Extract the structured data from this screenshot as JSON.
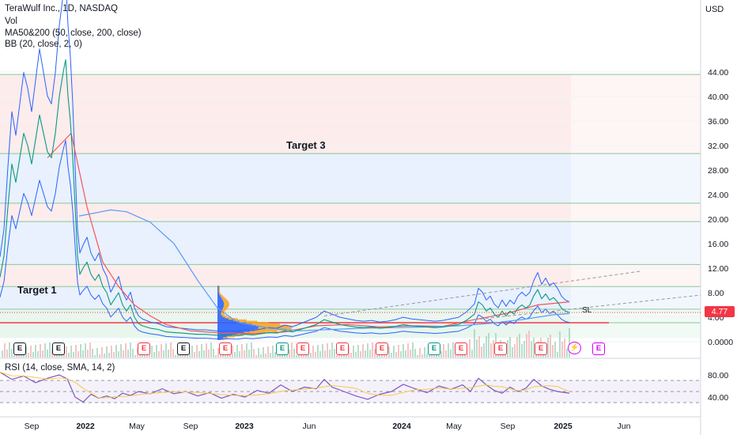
{
  "header": {
    "title": "TeraWulf Inc., 1D, NASDAQ",
    "vol_label": "Vol",
    "ma_label": "MA50&200 (50, close, 200, close)",
    "bb_label": "BB (20, close, 2, 0)",
    "rsi_label": "RSI (14, close, SMA, 14, 2)",
    "currency": "USD"
  },
  "annotations": {
    "target1": "Target 1",
    "target3": "Target 3",
    "sl": "SL",
    "last_price": "4.77"
  },
  "colors": {
    "price_line": "#f23645",
    "bb_band": "#2962ff",
    "ma50": "#f7525f",
    "ma200": "#5b9cf6",
    "rsi": "#7e57c2",
    "volume_profile_up": "#2962ff",
    "volume_profile_down": "#f5a623",
    "earnings_red": "#f23645",
    "earnings_green": "#089981",
    "zone_red": "#fdecec",
    "zone_blue": "#e8f1fd",
    "zone_green": "#e8f6ee"
  },
  "chart_data": [
    {
      "type": "line",
      "ylim": [
        0,
        48
      ],
      "y_ticks": [
        0,
        4,
        8,
        12,
        16,
        20,
        24,
        28,
        32,
        36,
        40,
        44
      ],
      "y_tick_labels": [
        "0.0000",
        "4.00",
        "8.00",
        "12.00",
        "16.00",
        "20.00",
        "24.00",
        "28.00",
        "32.00",
        "36.00",
        "40.00",
        "44.00"
      ],
      "x_tick_labels": [
        "Sep",
        "2022",
        "May",
        "Sep",
        "2023",
        "Jun",
        "2024",
        "May",
        "Sep",
        "2025",
        "Jun"
      ],
      "last_price": 4.77,
      "zones": [
        {
          "from": 30.7,
          "to": 43.6,
          "color": "red"
        },
        {
          "from": 22.6,
          "to": 30.7,
          "color": "blue"
        },
        {
          "from": 19.6,
          "to": 22.6,
          "color": "red"
        },
        {
          "from": 12.6,
          "to": 19.6,
          "color": "blue"
        },
        {
          "from": 9.0,
          "to": 12.6,
          "color": "red"
        },
        {
          "from": 5.3,
          "to": 9.0,
          "color": "blue"
        },
        {
          "from": 3.1,
          "to": 5.3,
          "color": "green"
        },
        {
          "from": 0.6,
          "to": 3.1,
          "color": "green"
        }
      ],
      "series": [
        {
          "values": [
            [
              0,
              10.5
            ],
            [
              5,
              14
            ],
            [
              10,
              22
            ],
            [
              15,
              29
            ],
            [
              20,
              26
            ],
            [
              25,
              30
            ],
            [
              30,
              34
            ],
            [
              35,
              32
            ],
            [
              40,
              29
            ],
            [
              45,
              33
            ],
            [
              50,
              37
            ],
            [
              55,
              34
            ],
            [
              60,
              31
            ],
            [
              65,
              30
            ],
            [
              70,
              34
            ],
            [
              75,
              40
            ],
            [
              80,
              44
            ],
            [
              83,
              46
            ],
            [
              86,
              40
            ],
            [
              89,
              36
            ],
            [
              92,
              30
            ],
            [
              95,
              22
            ],
            [
              98,
              14
            ],
            [
              101,
              11
            ],
            [
              105,
              12
            ],
            [
              110,
              13
            ],
            [
              115,
              11
            ],
            [
              120,
              10
            ],
            [
              125,
              11
            ],
            [
              130,
              9
            ],
            [
              135,
              8
            ],
            [
              140,
              6
            ],
            [
              145,
              7
            ],
            [
              150,
              8
            ],
            [
              155,
              6
            ],
            [
              160,
              5
            ],
            [
              165,
              6
            ],
            [
              170,
              4
            ],
            [
              175,
              3
            ],
            [
              180,
              2.6
            ],
            [
              190,
              2.2
            ],
            [
              200,
              2
            ],
            [
              210,
              1.6
            ],
            [
              220,
              1.5
            ],
            [
              230,
              1.4
            ],
            [
              240,
              1.3
            ],
            [
              250,
              1.2
            ],
            [
              260,
              1.2
            ],
            [
              270,
              1.1
            ],
            [
              280,
              1.0
            ],
            [
              290,
              1.1
            ],
            [
              300,
              1.0
            ],
            [
              310,
              1.2
            ],
            [
              320,
              1.1
            ],
            [
              330,
              1.3
            ],
            [
              340,
              1.5
            ],
            [
              350,
              1.4
            ],
            [
              360,
              1.8
            ],
            [
              370,
              1.6
            ],
            [
              380,
              2
            ],
            [
              390,
              2.4
            ],
            [
              400,
              2.8
            ],
            [
              410,
              3.6
            ],
            [
              420,
              3.2
            ],
            [
              430,
              2.8
            ],
            [
              440,
              2.6
            ],
            [
              450,
              2.4
            ],
            [
              460,
              2.3
            ],
            [
              470,
              2.4
            ],
            [
              480,
              2.2
            ],
            [
              490,
              2.3
            ],
            [
              500,
              2.5
            ],
            [
              510,
              2.8
            ],
            [
              520,
              2.6
            ],
            [
              530,
              2.5
            ],
            [
              540,
              2.4
            ],
            [
              550,
              2.3
            ],
            [
              560,
              2.4
            ],
            [
              570,
              2.6
            ],
            [
              580,
              2.8
            ],
            [
              590,
              3.5
            ],
            [
              600,
              4.5
            ],
            [
              605,
              6.5
            ],
            [
              610,
              6
            ],
            [
              615,
              5
            ],
            [
              620,
              5.5
            ],
            [
              625,
              4.5
            ],
            [
              630,
              4
            ],
            [
              635,
              5
            ],
            [
              640,
              4.2
            ],
            [
              645,
              5
            ],
            [
              650,
              4.5
            ],
            [
              655,
              5.5
            ],
            [
              660,
              6
            ],
            [
              665,
              5.5
            ],
            [
              670,
              6
            ],
            [
              675,
              7.5
            ],
            [
              680,
              8.5
            ],
            [
              685,
              7
            ],
            [
              690,
              7.8
            ],
            [
              695,
              6.8
            ],
            [
              700,
              7.2
            ],
            [
              705,
              6.5
            ],
            [
              710,
              5.5
            ],
            [
              715,
              5
            ],
            [
              720,
              4.77
            ]
          ]
        },
        {
          "name": "",
          "values": [
            [
              60,
              30
            ],
            [
              90,
              34
            ],
            [
              110,
              22
            ],
            [
              130,
              13
            ],
            [
              150,
              9
            ],
            [
              170,
              6
            ],
            [
              190,
              4.2
            ],
            [
              210,
              2.8
            ],
            [
              240,
              1.8
            ],
            [
              280,
              1.4
            ],
            [
              320,
              1.3
            ],
            [
              360,
              1.6
            ],
            [
              400,
              2.6
            ],
            [
              440,
              2.8
            ],
            [
              480,
              2.4
            ],
            [
              520,
              2.6
            ],
            [
              560,
              2.5
            ],
            [
              600,
              3.6
            ],
            [
              640,
              4.6
            ],
            [
              680,
              6
            ],
            [
              720,
              6.5
            ]
          ]
        },
        {
          "name": "",
          "values": [
            [
              100,
              20.5
            ],
            [
              140,
              21.5
            ],
            [
              160,
              21.2
            ],
            [
              190,
              19.5
            ],
            [
              220,
              16
            ],
            [
              250,
              10
            ],
            [
              275,
              5.5
            ],
            [
              300,
              3.2
            ],
            [
              340,
              2.2
            ],
            [
              380,
              1.8
            ],
            [
              420,
              2
            ],
            [
              460,
              2.2
            ],
            [
              500,
              2.3
            ],
            [
              540,
              2.4
            ],
            [
              580,
              2.6
            ],
            [
              620,
              3
            ],
            [
              660,
              3.6
            ],
            [
              700,
              4.4
            ],
            [
              720,
              4.6
            ]
          ]
        }
      ]
    },
    {
      "type": "line",
      "title": "",
      "ylim": [
        20,
        100
      ],
      "y_ticks": [
        40,
        80
      ],
      "y_tick_labels": [
        "40.00",
        "80.00"
      ],
      "series": [
        {
          "name": "",
          "values": [
            [
              0,
              85
            ],
            [
              15,
              72
            ],
            [
              30,
              78
            ],
            [
              45,
              66
            ],
            [
              60,
              74
            ],
            [
              75,
              80
            ],
            [
              85,
              73
            ],
            [
              95,
              40
            ],
            [
              105,
              31
            ],
            [
              115,
              45
            ],
            [
              125,
              38
            ],
            [
              135,
              42
            ],
            [
              145,
              37
            ],
            [
              155,
              47
            ],
            [
              165,
              43
            ],
            [
              175,
              50
            ],
            [
              190,
              46
            ],
            [
              205,
              55
            ],
            [
              220,
              46
            ],
            [
              235,
              50
            ],
            [
              250,
              42
            ],
            [
              265,
              48
            ],
            [
              280,
              38
            ],
            [
              295,
              45
            ],
            [
              310,
              40
            ],
            [
              325,
              52
            ],
            [
              340,
              47
            ],
            [
              355,
              62
            ],
            [
              370,
              50
            ],
            [
              385,
              58
            ],
            [
              400,
              55
            ],
            [
              410,
              72
            ],
            [
              420,
              58
            ],
            [
              435,
              50
            ],
            [
              450,
              42
            ],
            [
              465,
              36
            ],
            [
              480,
              45
            ],
            [
              495,
              50
            ],
            [
              510,
              63
            ],
            [
              525,
              55
            ],
            [
              540,
              48
            ],
            [
              555,
              60
            ],
            [
              570,
              54
            ],
            [
              585,
              62
            ],
            [
              595,
              50
            ],
            [
              605,
              74
            ],
            [
              615,
              62
            ],
            [
              625,
              52
            ],
            [
              635,
              47
            ],
            [
              645,
              58
            ],
            [
              655,
              50
            ],
            [
              665,
              56
            ],
            [
              675,
              72
            ],
            [
              685,
              60
            ],
            [
              695,
              54
            ],
            [
              705,
              50
            ],
            [
              715,
              48
            ],
            [
              720,
              47
            ]
          ]
        }
      ]
    }
  ]
}
